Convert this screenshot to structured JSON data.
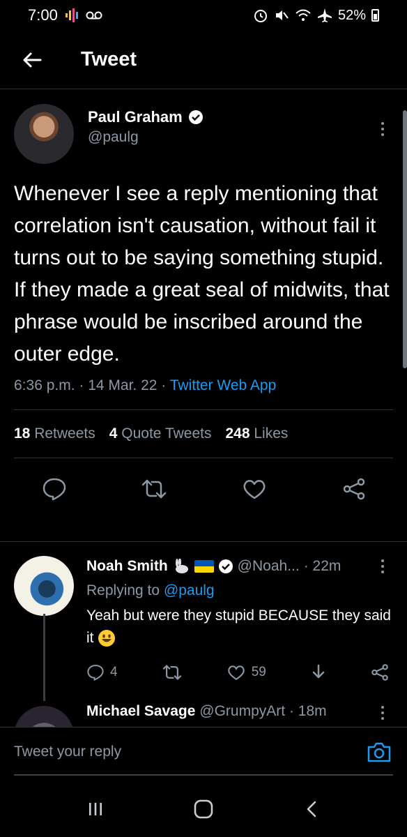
{
  "status_bar": {
    "time": "7:00",
    "battery": "52%"
  },
  "header": {
    "title": "Tweet"
  },
  "tweet": {
    "author_name": "Paul Graham",
    "handle": "@paulg",
    "text": "Whenever I see a reply mentioning that correlation isn't causation, without fail it turns out to be saying something stupid. If they made a great seal of midwits, that phrase would be inscribed around the outer edge.",
    "timestamp": "6:36 p.m. · 14 Mar. 22 · ",
    "source": "Twitter Web App",
    "retweets_count": "18",
    "retweets_label": "Retweets",
    "quotes_count": "4",
    "quotes_label": "Quote Tweets",
    "likes_count": "248",
    "likes_label": "Likes"
  },
  "reply": {
    "author_name": "Noah Smith",
    "handle": "@Noah...",
    "time": "· 22m",
    "replying_label": "Replying to ",
    "replying_handle": "@paulg",
    "text": "Yeah but were they stupid BECAUSE they said it",
    "reply_count": "4",
    "like_count": "59"
  },
  "next_reply": {
    "author_name": "Michael Savage",
    "handle": "@GrumpyArt",
    "time": "· 18m"
  },
  "compose": {
    "placeholder": "Tweet your reply"
  },
  "colors": {
    "accent": "#1d9bf0",
    "muted": "#8b98a5",
    "background": "#000000"
  }
}
